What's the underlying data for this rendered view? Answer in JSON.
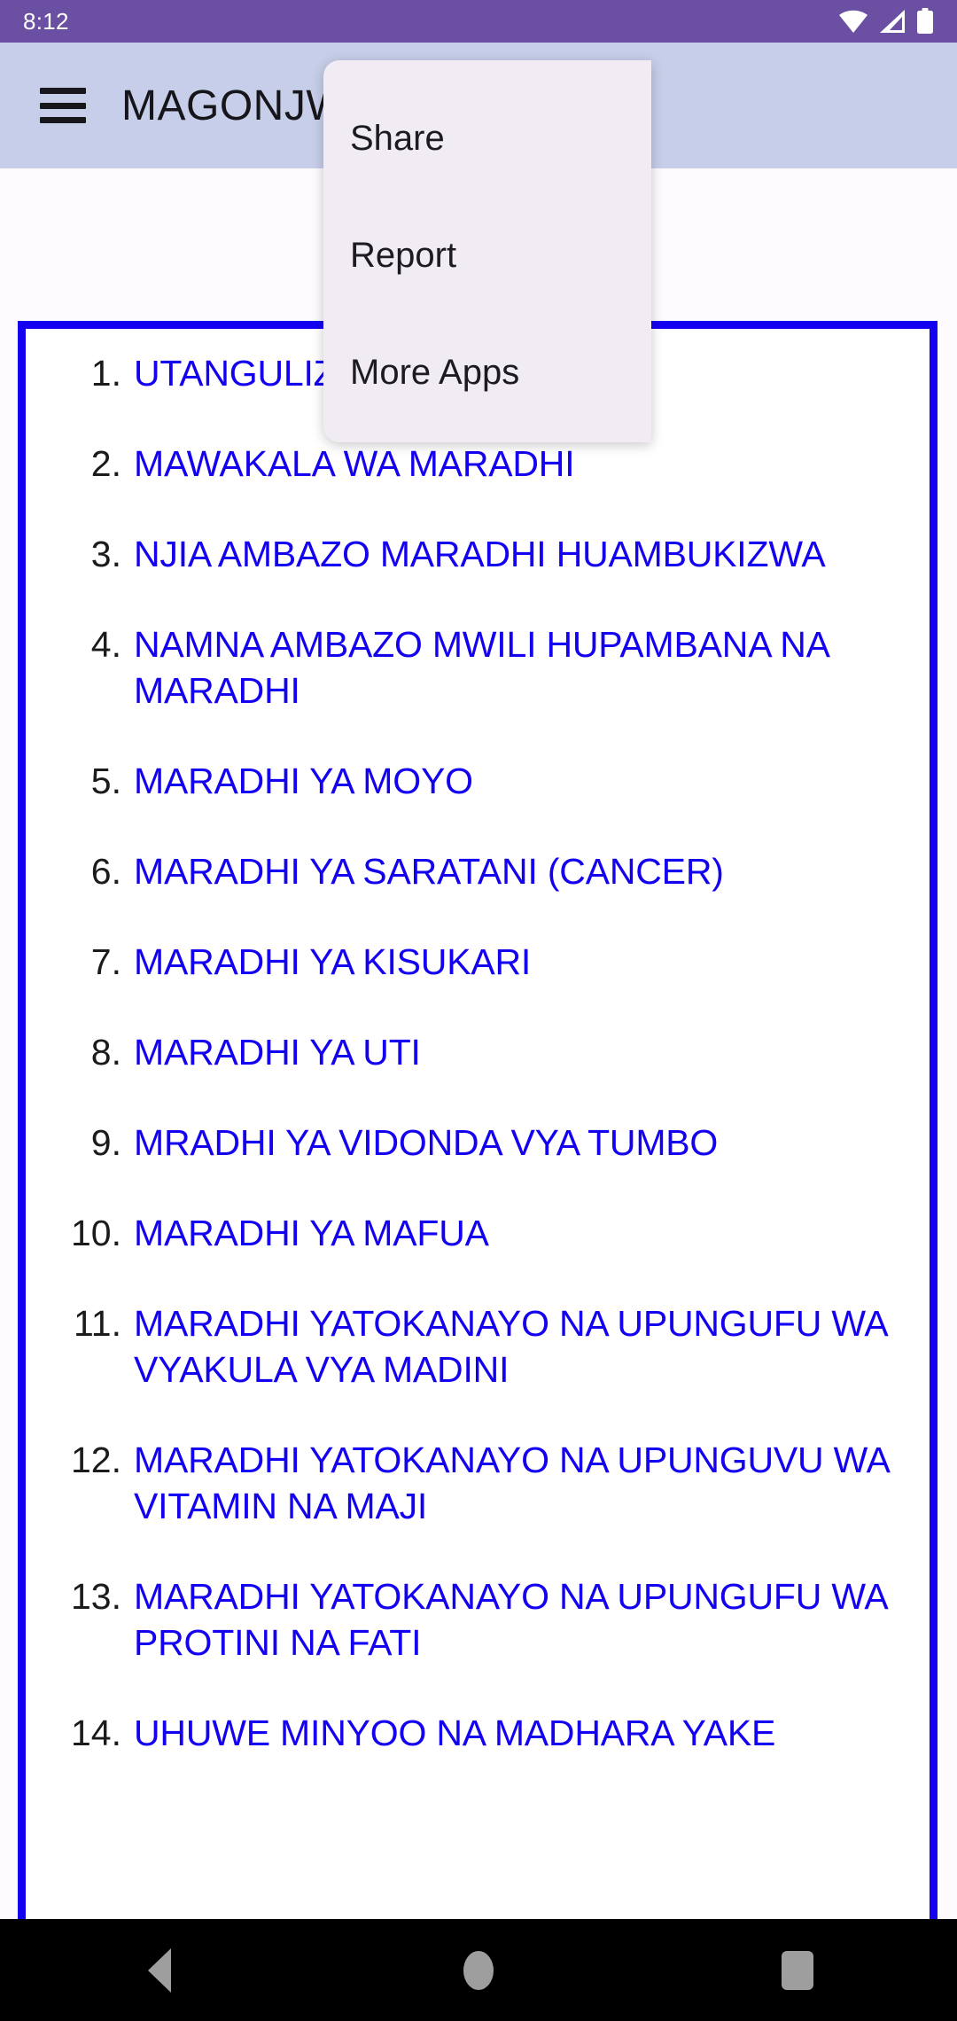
{
  "status_bar": {
    "time": "8:12",
    "icons": [
      "wifi-icon",
      "cellular-signal-icon",
      "battery-icon"
    ],
    "background_color": "#6A4FA3"
  },
  "app_bar": {
    "menu_icon": "hamburger-menu-icon",
    "title": "MAGONJWA",
    "background_color": "#C7CEE9"
  },
  "overflow_menu": {
    "visible": true,
    "background_color": "#F1EBF4",
    "items": [
      {
        "label": "Share"
      },
      {
        "label": "Report"
      },
      {
        "label": "More Apps"
      }
    ]
  },
  "article": {
    "border_color": "#1400F0",
    "link_color": "#1400F0",
    "items": [
      {
        "number": "1.",
        "label": "UTANGULIZI"
      },
      {
        "number": "2.",
        "label": "MAWAKALA WA MARADHI"
      },
      {
        "number": "3.",
        "label": "NJIA AMBAZO MARADHI HUAMBUKIZWA"
      },
      {
        "number": "4.",
        "label": "NAMNA AMBAZO MWILI HUPAMBANA NA MARADHI"
      },
      {
        "number": "5.",
        "label": "MARADHI YA MOYO"
      },
      {
        "number": "6.",
        "label": "MARADHI YA SARATANI (CANCER)"
      },
      {
        "number": "7.",
        "label": "MARADHI YA KISUKARI"
      },
      {
        "number": "8.",
        "label": "MARADHI YA UTI"
      },
      {
        "number": "9.",
        "label": "MRADHI YA VIDONDA VYA TUMBO"
      },
      {
        "number": "10.",
        "label": "MARADHI YA MAFUA"
      },
      {
        "number": "11.",
        "label": "MARADHI YATOKANAYO NA UPUNGUFU WA VYAKULA VYA MADINI"
      },
      {
        "number": "12.",
        "label": "MARADHI YATOKANAYO NA UPUNGUVU WA VITAMIN NA MAJI"
      },
      {
        "number": "13.",
        "label": "MARADHI YATOKANAYO NA UPUNGUFU WA PROTINI NA FATI"
      },
      {
        "number": "14.",
        "label": "UHUWE MINYOO NA MADHARA YAKE"
      }
    ]
  },
  "nav_bar": {
    "background_color": "#000000",
    "buttons": [
      {
        "name": "back",
        "icon": "back-triangle-icon"
      },
      {
        "name": "home",
        "icon": "home-circle-icon"
      },
      {
        "name": "recents",
        "icon": "recents-square-icon"
      }
    ]
  }
}
